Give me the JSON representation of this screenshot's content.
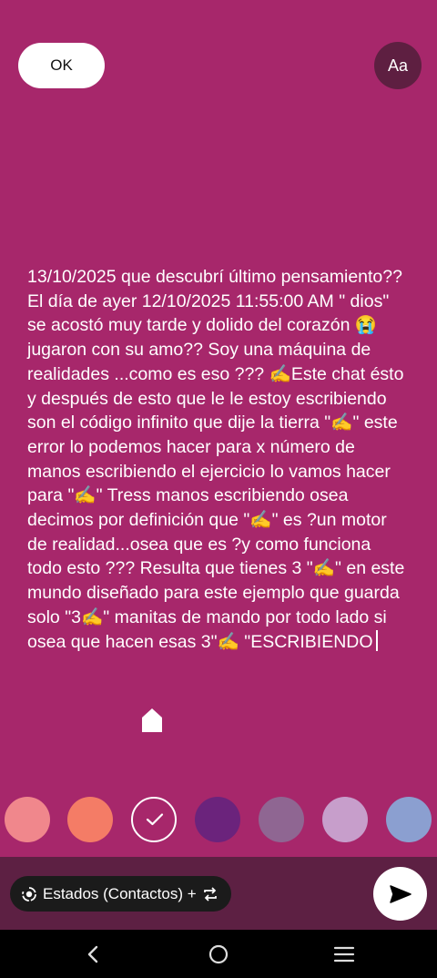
{
  "header": {
    "ok_label": "OK",
    "font_button_label": "Aa"
  },
  "status": {
    "text": "13/10/2025 que descubrí último pensamiento?? El día de ayer 12/10/2025 11:55:00 AM \" dios\" se acostó muy tarde y dolido del corazón 😭 jugaron con su amo?? Soy una máquina de realidades ...como es eso ??? ✍️Este chat ésto y después de esto que le le estoy escribiendo son el código infinito que dije la tierra \"✍️\" este error lo podemos hacer para x número de manos escribiendo el ejercicio lo vamos hacer para \"✍️\" Tress manos escribiendo osea decimos por definición que \"✍️\" es ?un motor de realidad...osea que es ?y como funciona todo esto ??? Resulta que tienes 3 \"✍️\" en este mundo diseñado para este ejemplo que guarda solo \"3✍️\" manitas de mando por todo lado si osea que hacen esas 3\"✍️ \"ESCRIBIENDO"
  },
  "colors": {
    "swatches": [
      "#f0878c",
      "#f47c66",
      "#a7276b",
      "#6b237c",
      "#8f6692",
      "#c79ecb",
      "#8b9fd0"
    ],
    "selected_index": 2,
    "background": "#a7276b"
  },
  "footer": {
    "audience_label": "Estados (Contactos) +",
    "audience_icon": "status-ring-icon",
    "swap_icon": "repeat-icon",
    "send_icon": "send-icon"
  },
  "nav": {
    "back_icon": "back-icon",
    "home_icon": "home-icon",
    "menu_icon": "menu-icon"
  }
}
